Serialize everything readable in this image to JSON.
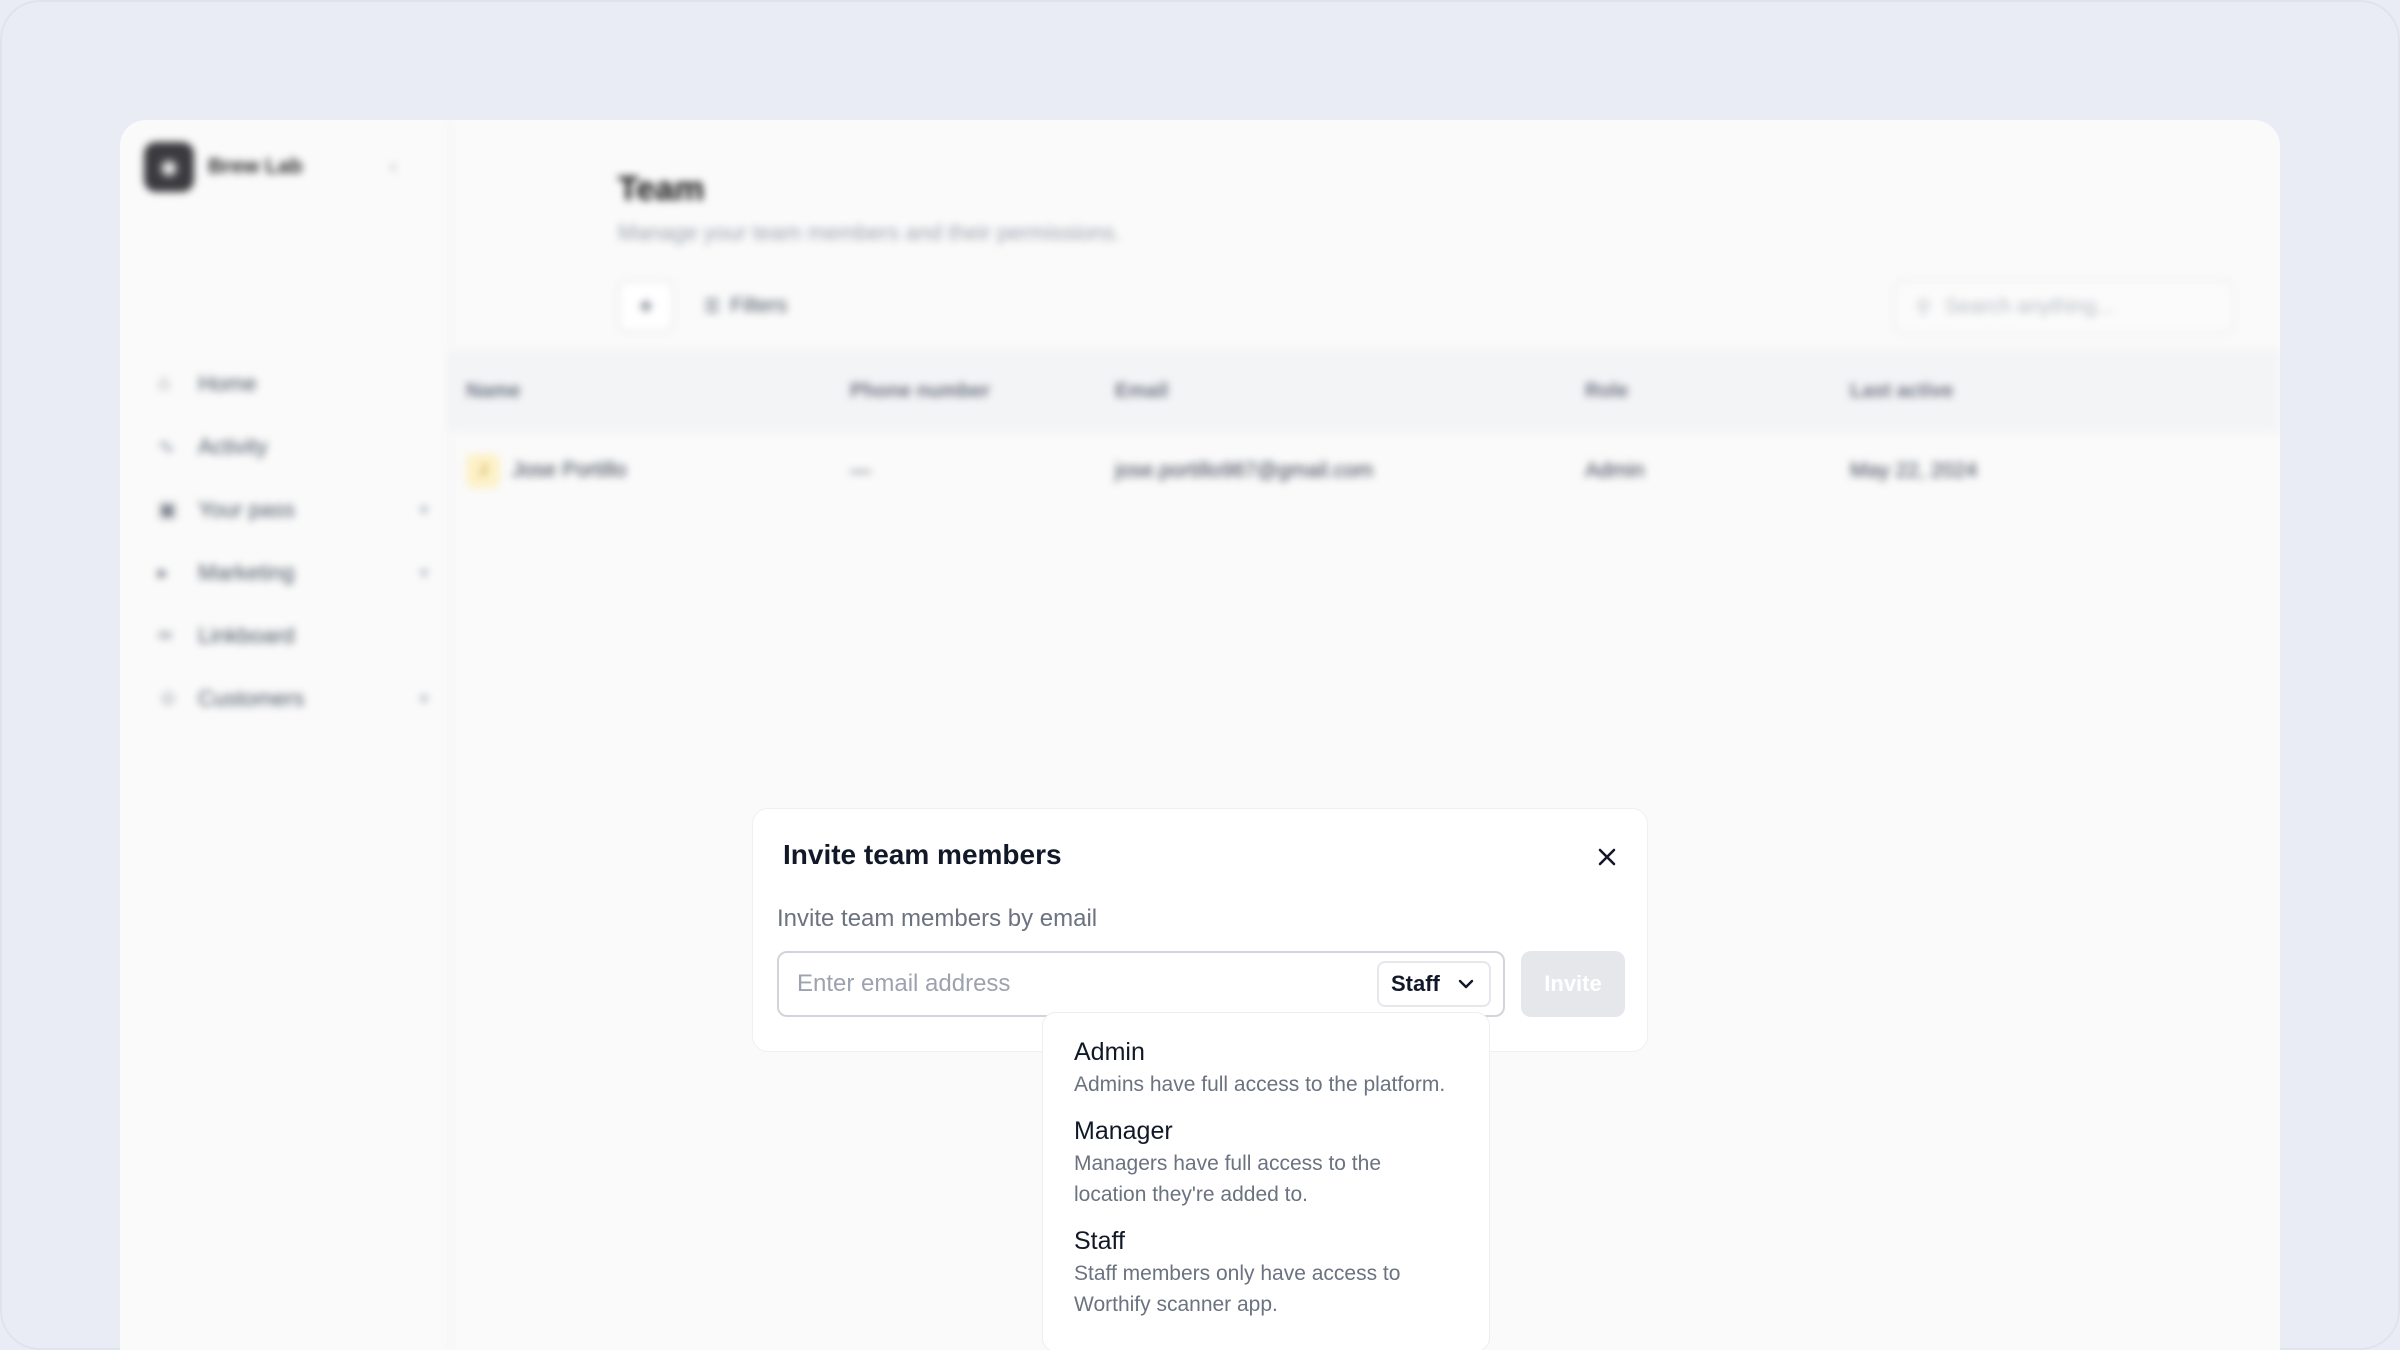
{
  "app": {
    "brand": {
      "name": "Brew Lab",
      "logo_icon": "logo-icon"
    },
    "sidebar": {
      "items": [
        {
          "label": "Home",
          "icon": "home-icon",
          "has_children": false
        },
        {
          "label": "Activity",
          "icon": "activity-icon",
          "has_children": false
        },
        {
          "label": "Your pass",
          "icon": "pass-icon",
          "has_children": true
        },
        {
          "label": "Marketing",
          "icon": "marketing-icon",
          "has_children": true
        },
        {
          "label": "Linkboard",
          "icon": "link-icon",
          "has_children": false
        },
        {
          "label": "Customers",
          "icon": "customers-icon",
          "has_children": true
        }
      ]
    },
    "page": {
      "title": "Team",
      "subtitle": "Manage your team members and their permissions.",
      "add_label": "+",
      "filters_label": "Filters",
      "search_placeholder": "Search anything..."
    },
    "table": {
      "columns": [
        "Name",
        "Phone number",
        "Email",
        "Role",
        "Last active"
      ],
      "rows": [
        {
          "avatar": "J",
          "name": "Jose Portillo",
          "phone": "—",
          "email": "jose.portillo987@gmail.com",
          "role": "Admin",
          "last_active": "May 22, 2024"
        }
      ]
    }
  },
  "modal": {
    "title": "Invite team members",
    "close_icon": "close-icon",
    "label": "Invite team members by email",
    "email_placeholder": "Enter email address",
    "email_value": "",
    "role_selected": "Staff",
    "invite_label": "Invite"
  },
  "role_dropdown": {
    "options": [
      {
        "name": "Admin",
        "description": "Admins have full access to the platform."
      },
      {
        "name": "Manager",
        "description": "Managers have full access to the location they're added to."
      },
      {
        "name": "Staff",
        "description": "Staff members only have access to Worthify scanner app."
      }
    ]
  }
}
